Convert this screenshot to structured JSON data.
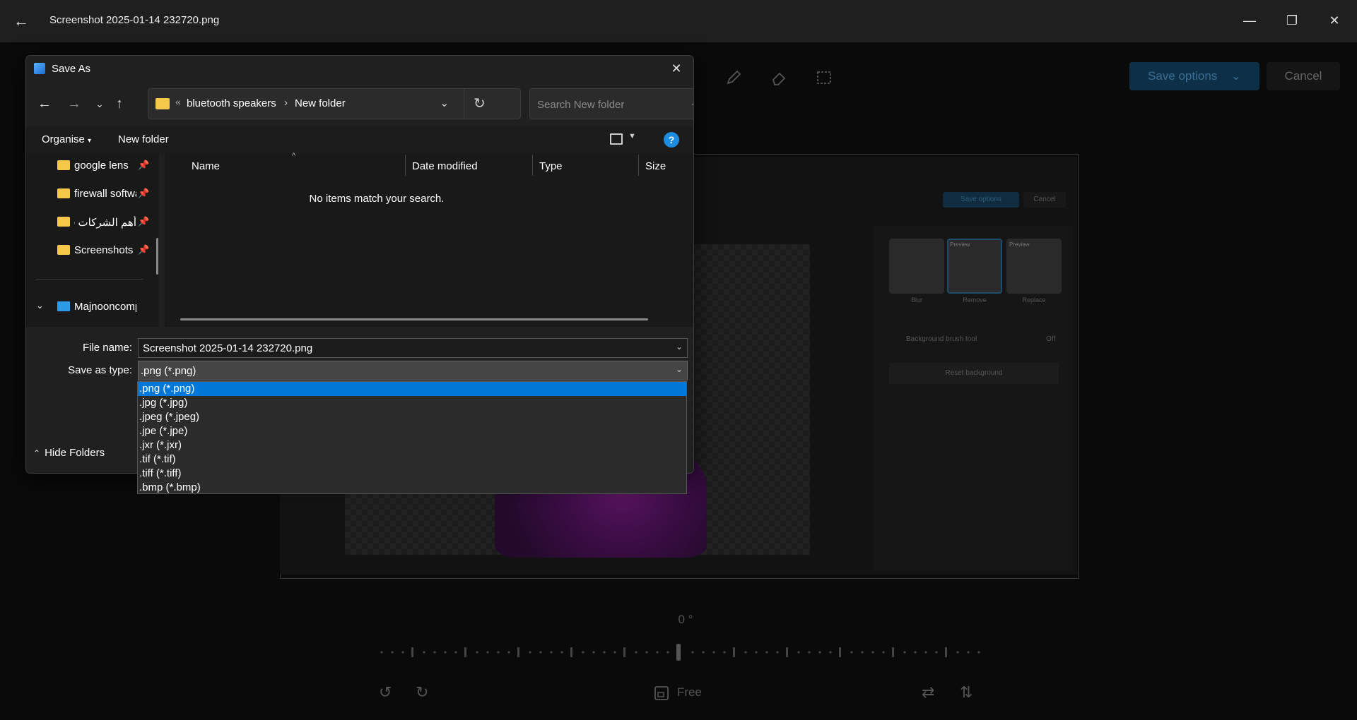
{
  "app": {
    "title": "Screenshot 2025-01-14 232720.png",
    "save_options_label": "Save options",
    "cancel_label": "Cancel",
    "angle_readout": "0 °",
    "free_label": "Free",
    "nested": {
      "save_options_label": "Save options",
      "cancel_label": "Cancel",
      "thumbs": [
        "Blur",
        "Remove",
        "Replace"
      ],
      "preview_badge": "Preview",
      "brush_label": "Background brush tool",
      "brush_state": "Off",
      "reset_label": "Reset background"
    }
  },
  "dialog": {
    "title": "Save As",
    "address": {
      "overflow": "«",
      "crumbs": [
        "bluetooth speakers",
        "New folder"
      ],
      "separator": "›"
    },
    "search_placeholder": "Search New folder",
    "organise_label": "Organise",
    "new_folder_label": "New folder",
    "help_label": "?",
    "tree": [
      {
        "label": "google lens"
      },
      {
        "label": "firewall software"
      },
      {
        "label": "أهم الشركات في"
      },
      {
        "label": "Screenshots"
      }
    ],
    "this_pc_label": "Majnooncomputer",
    "columns": [
      "Name",
      "Date modified",
      "Type",
      "Size"
    ],
    "empty_message": "No items match your search.",
    "file_name_label": "File name:",
    "file_name_value": "Screenshot 2025-01-14 232720.png",
    "save_as_type_label": "Save as type:",
    "save_as_type_value": ".png (*.png)",
    "hide_folders_label": "Hide Folders",
    "type_options": [
      ".png (*.png)",
      ".jpg (*.jpg)",
      ".jpeg (*.jpeg)",
      ".jpe (*.jpe)",
      ".jxr (*.jxr)",
      ".tif (*.tif)",
      ".tiff (*.tiff)",
      ".bmp (*.bmp)"
    ],
    "selected_type_index": 0
  },
  "colors": {
    "accent": "#0078d7",
    "folder": "#f5c84c",
    "help": "#1c8de0"
  }
}
